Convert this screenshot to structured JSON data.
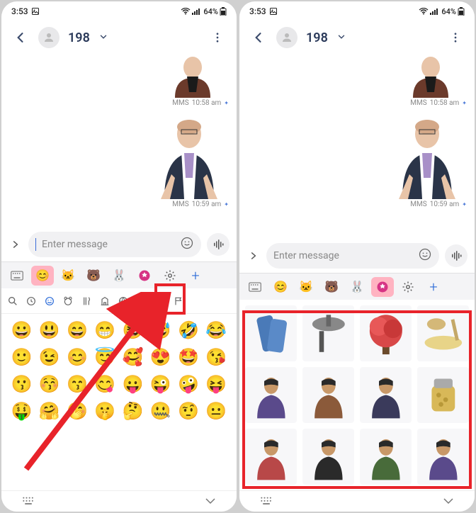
{
  "status": {
    "time": "3:53",
    "battery": "64%"
  },
  "header": {
    "contact": "198"
  },
  "messages": {
    "meta1_type": "MMS",
    "meta1_time": "10:58 am",
    "meta2_type": "MMS",
    "meta2_time": "10:59 am"
  },
  "input": {
    "placeholder": "Enter message"
  },
  "keyboard": {
    "tabs": {
      "face": "😊",
      "cat": "🐱",
      "bear": "🐻",
      "rabbit": "🐰",
      "gallery": "✦"
    },
    "emoji_rows": [
      [
        "😀",
        "😃",
        "😄",
        "😁",
        "😆",
        "😅",
        "🤣",
        "😂"
      ],
      [
        "🙂",
        "😉",
        "😊",
        "😇",
        "🥰",
        "😍",
        "🤩",
        "😘"
      ],
      [
        "😗",
        "😚",
        "😙",
        "😋",
        "😛",
        "😜",
        "🤪",
        "😝"
      ],
      [
        "🤑",
        "🤗",
        "🤭",
        "🤫",
        "🤔",
        "🤐",
        "🤨",
        "😐"
      ]
    ]
  },
  "stickers": {
    "items": [
      "glass",
      "dryer",
      "tree",
      "dish",
      "man1",
      "man2",
      "man3",
      "jar",
      "man4",
      "man5",
      "man6",
      "man7"
    ]
  }
}
